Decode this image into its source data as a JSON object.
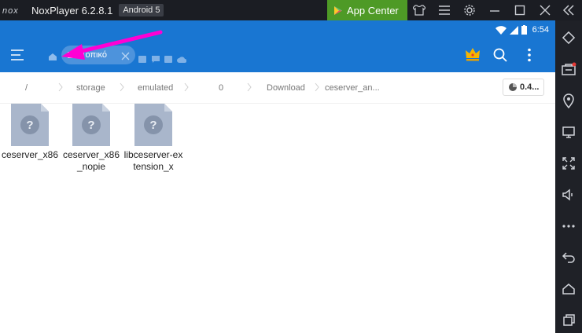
{
  "window": {
    "title": "NoxPlayer 6.2.8.1",
    "android_version": "Android 5",
    "app_center_label": "App Center"
  },
  "statusbar": {
    "time": "6:54"
  },
  "appbar": {
    "tab_label": "Τοπικό"
  },
  "breadcrumb": {
    "items": [
      "/",
      "storage",
      "emulated",
      "0",
      "Download",
      "ceserver_an..."
    ]
  },
  "storage_chip": {
    "label": "0.4..."
  },
  "files": [
    {
      "name": "ceserver_x86"
    },
    {
      "name": "ceserver_x86_nopie"
    },
    {
      "name": "libceserver-extension_x"
    }
  ],
  "icons": {
    "nox_logo": "nox-logo-icon",
    "play": "play-store-icon",
    "shirt": "theme-icon",
    "menu": "menu-icon",
    "settings": "gear-icon",
    "minimize": "minimize-icon",
    "maximize": "maximize-icon",
    "close": "close-icon"
  },
  "colors": {
    "accent": "#1976d2",
    "app_center": "#4e9a26",
    "annotation": "#ff00d4",
    "file_icon": "#a9b6cb"
  }
}
